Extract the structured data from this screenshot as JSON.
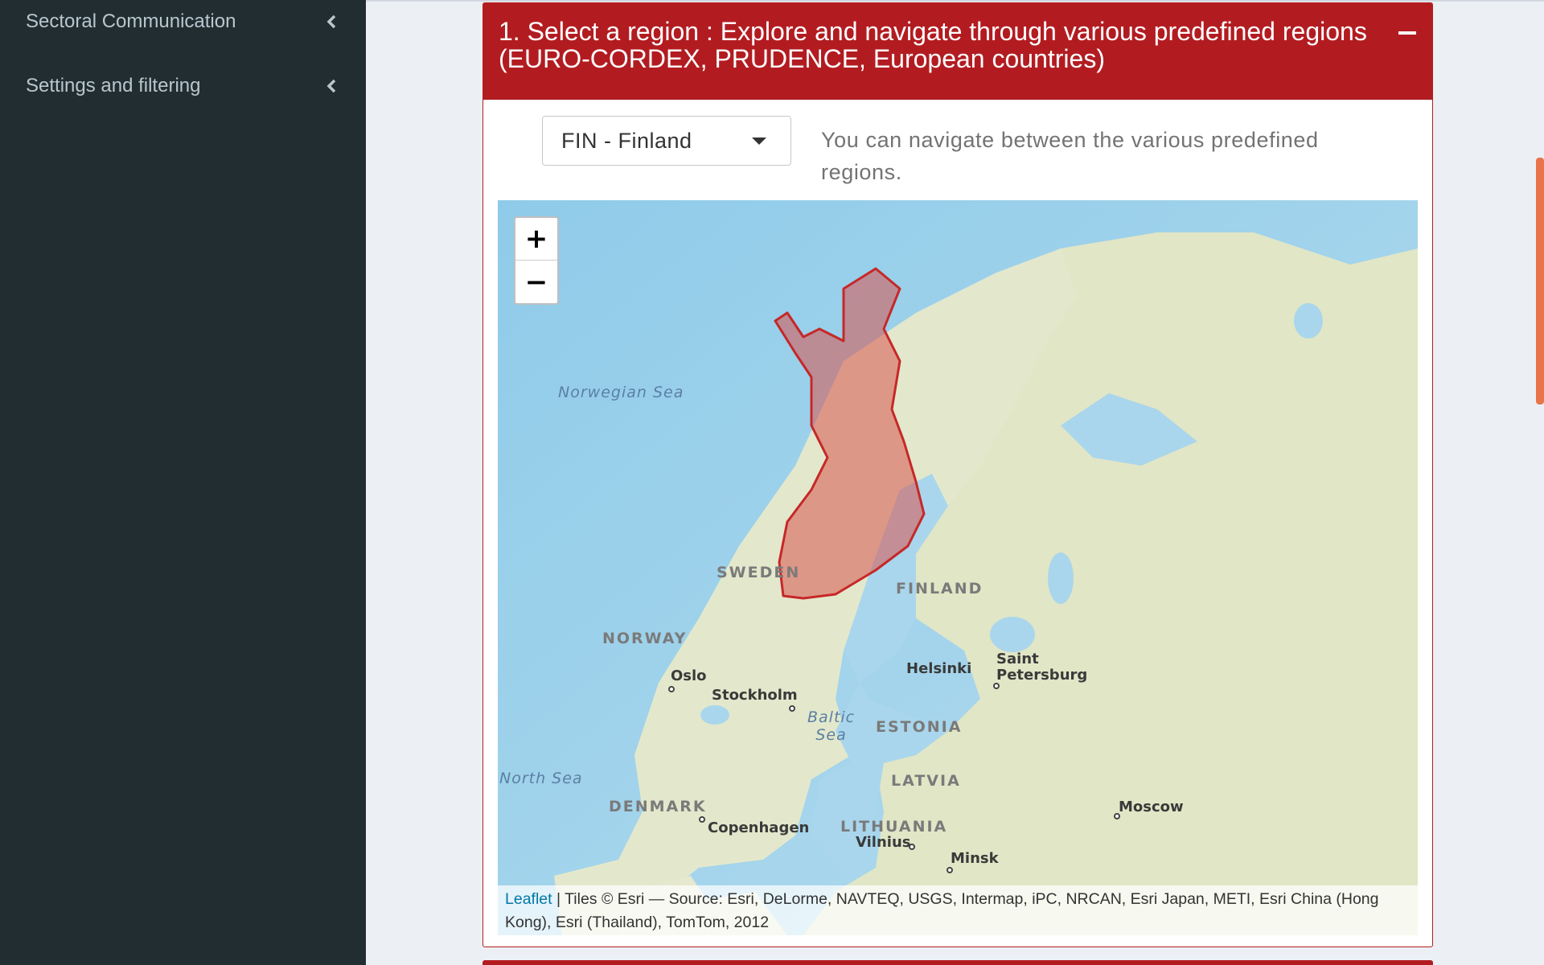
{
  "sidebar": {
    "items": [
      {
        "label": "Sectoral Communication",
        "icon": "chevron-left-icon"
      },
      {
        "label": "Settings and filtering",
        "icon": "chevron-left-icon"
      }
    ]
  },
  "region_box": {
    "title": "1. Select a region : Explore and navigate through various predefined regions (EURO-CORDEX, PRUDENCE, European countries)",
    "collapse_icon": "minus-icon",
    "select_value": "FIN - Finland",
    "help_text": "You can navigate between the various predefined regions."
  },
  "map": {
    "zoom_in": "+",
    "zoom_out": "−",
    "highlighted_region": "Finland",
    "highlight_color": "#d9534f",
    "labels": {
      "norwegian_sea": "Norwegian Sea",
      "north_sea": "North Sea",
      "baltic_sea": "Baltic Sea",
      "sweden": "SWEDEN",
      "norway": "NORWAY",
      "finland": "FINLAND",
      "estonia": "ESTONIA",
      "latvia": "LATVIA",
      "lithuania": "LITHUANIA",
      "denmark": "DENMARK",
      "oslo": "Oslo",
      "stockholm": "Stockholm",
      "helsinki": "Helsinki",
      "saint_petersburg_1": "Saint",
      "saint_petersburg_2": "Petersburg",
      "copenhagen": "Copenhagen",
      "vilnius": "Vilnius",
      "minsk": "Minsk",
      "moscow": "Moscow"
    },
    "attribution": {
      "link": "Leaflet",
      "text": " | Tiles © Esri — Source: Esri, DeLorme, NAVTEQ, USGS, Intermap, iPC, NRCAN, Esri Japan, METI, Esri China (Hong Kong), Esri (Thailand), TomTom, 2012"
    }
  },
  "colors": {
    "sidebar_bg": "#222d32",
    "box_header": "#b21c21",
    "scrollbar": "#e8744a"
  }
}
